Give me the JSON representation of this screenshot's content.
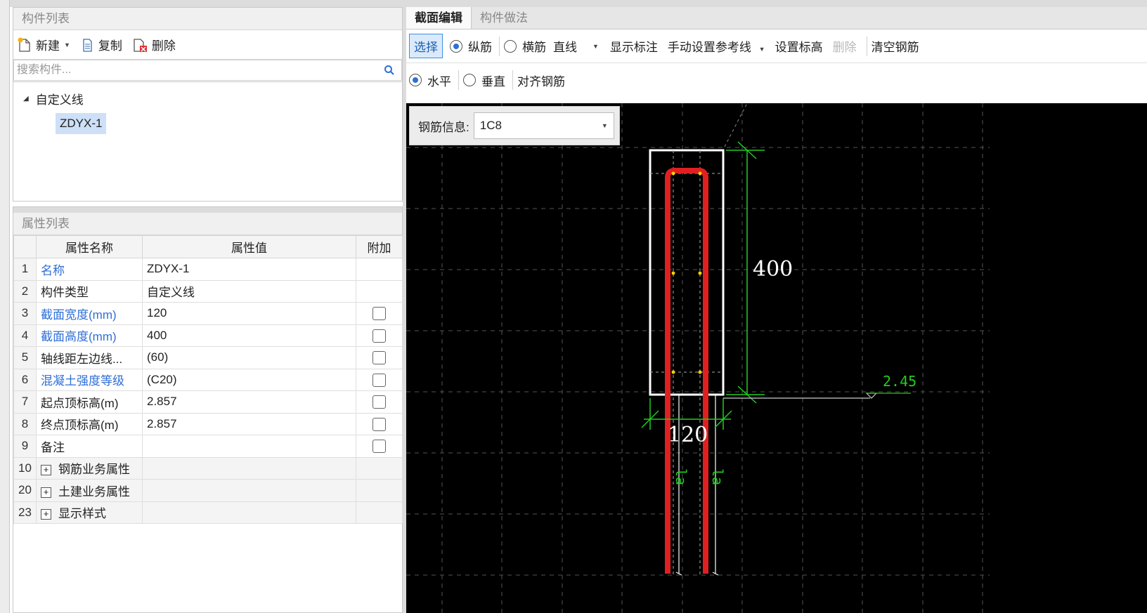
{
  "component_list": {
    "title": "构件列表",
    "toolbar": {
      "new_label": "新建",
      "copy_label": "复制",
      "delete_label": "删除"
    },
    "search_placeholder": "搜索构件...",
    "tree": {
      "root_label": "自定义线",
      "child_label": "ZDYX-1"
    }
  },
  "property_list": {
    "title": "属性列表",
    "headers": {
      "name": "属性名称",
      "value": "属性值",
      "extra": "附加"
    },
    "rows": [
      {
        "index": "1",
        "name": "名称",
        "value": "ZDYX-1"
      },
      {
        "index": "2",
        "name": "构件类型",
        "value": "自定义线"
      },
      {
        "index": "3",
        "name": "截面宽度(mm)",
        "value": "120"
      },
      {
        "index": "4",
        "name": "截面高度(mm)",
        "value": "400"
      },
      {
        "index": "5",
        "name": "轴线距左边线...",
        "value": "(60)"
      },
      {
        "index": "6",
        "name": "混凝土强度等级",
        "value": "(C20)"
      },
      {
        "index": "7",
        "name": "起点顶标高(m)",
        "value": "2.857"
      },
      {
        "index": "8",
        "name": "终点顶标高(m)",
        "value": "2.857"
      },
      {
        "index": "9",
        "name": "备注",
        "value": ""
      }
    ],
    "groups": [
      {
        "index": "10",
        "name": "钢筋业务属性"
      },
      {
        "index": "20",
        "name": "土建业务属性"
      },
      {
        "index": "23",
        "name": "显示样式"
      }
    ]
  },
  "editor": {
    "tabs": [
      "截面编辑",
      "构件做法"
    ],
    "toolbar1": {
      "select": "选择",
      "longitudinal": "纵筋",
      "transverse": "横筋",
      "line_mode": "直线",
      "show_dims": "显示标注",
      "manual_ref_line": "手动设置参考线",
      "set_elevation": "设置标高",
      "delete": "删除",
      "clear_rebar": "清空钢筋"
    },
    "toolbar2": {
      "horizontal": "水平",
      "vertical": "垂直",
      "align_rebar": "对齐钢筋"
    },
    "rebar_info": {
      "label": "钢筋信息:",
      "value": "1C8"
    },
    "drawing": {
      "height_dim": "400",
      "width_dim": "120",
      "elevation": "2.45",
      "anchor_label": "la"
    }
  },
  "colors": {
    "accent_blue": "#2f6fd6",
    "rebar_red": "#e02020",
    "dim_green": "#22cc22",
    "canvas_bg": "#000000"
  }
}
